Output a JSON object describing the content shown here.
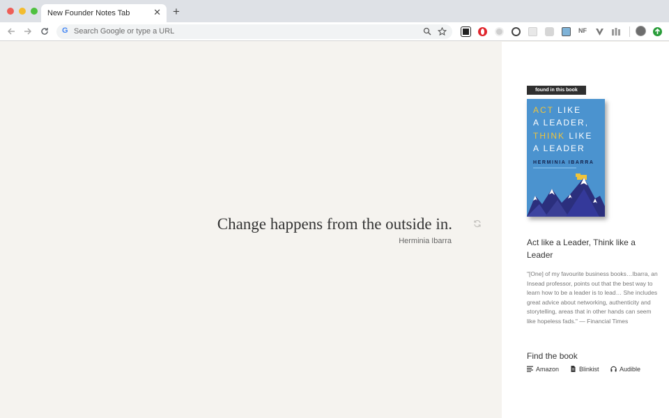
{
  "browser": {
    "tab_title": "New Founder Notes Tab",
    "tab_close": "✕",
    "new_tab": "+",
    "omnibox_placeholder": "Search Google or type a URL",
    "google_mark": "G",
    "extensions": [
      "qr-code",
      "opera",
      "circle",
      "at-sign",
      "blank",
      "chat",
      "image",
      "NF",
      "vpn",
      "bars",
      "avatar",
      "update"
    ],
    "ext_nf_label": "NF"
  },
  "quote": {
    "text": "Change happens from the outside in.",
    "author": "Herminia Ibarra"
  },
  "sidebar": {
    "found_label": "found in this book",
    "cover": {
      "line1_highlight": "ACT",
      "line1_rest": " LIKE",
      "line2": "A LEADER,",
      "line3_highlight": "THINK",
      "line3_rest": " LIKE",
      "line4": "A LEADER",
      "author": "HERMINIA IBARRA"
    },
    "book_title": "Act like a Leader, Think like a Leader",
    "blurb": "\"[One] of my favourite business books…Ibarra, an Insead professor, points out that the best way to learn how to be a leader is to lead… She includes great advice about networking, authenticity and storytelling, areas that in other hands can seem like hopeless fads.\" — Financial Times",
    "find_heading": "Find the book",
    "links": [
      {
        "label": "Amazon",
        "icon": "list-icon"
      },
      {
        "label": "Blinkist",
        "icon": "document-icon"
      },
      {
        "label": "Audible",
        "icon": "headphones-icon"
      }
    ]
  },
  "colors": {
    "quote_bg": "#f5f3ef",
    "sidebar_bg": "#ffffff",
    "cover_blue": "#4b93cf",
    "cover_accent": "#f0c43a"
  }
}
